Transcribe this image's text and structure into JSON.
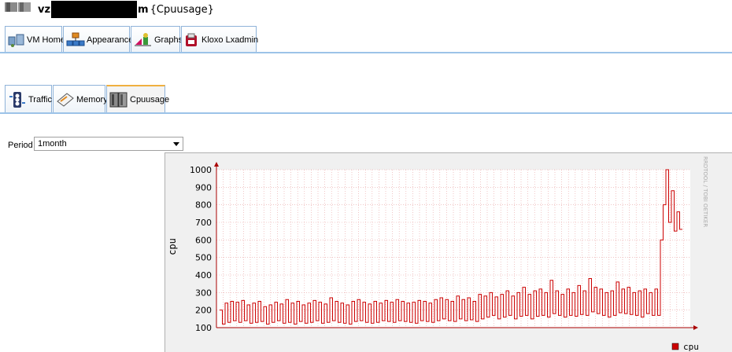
{
  "header": {
    "title_prefix": "vz",
    "title_suffix_bold": "m",
    "title_suffix": "{Cpuusage}"
  },
  "main_tabs": [
    {
      "label": "VM Home",
      "icon": "vm-home-icon"
    },
    {
      "label": "Appearance",
      "icon": "appearance-icon"
    },
    {
      "label": "Graphs",
      "icon": "graphs-icon"
    },
    {
      "label": "Kloxo Lxadmin",
      "icon": "kloxo-icon"
    }
  ],
  "graph_tabs": [
    {
      "label": "Traffic",
      "icon": "traffic-icon",
      "active": false
    },
    {
      "label": "Memory",
      "icon": "memory-icon",
      "active": false
    },
    {
      "label": "Cpuusage",
      "icon": "cpu-icon",
      "active": true
    }
  ],
  "period": {
    "label": "Period",
    "selected": "1month"
  },
  "colors": {
    "line": "#cc0000",
    "grid": "#e8a0a0",
    "tab_border": "#8fb3d9",
    "active_tab_top": "#f0b040"
  },
  "chart_data": {
    "type": "line",
    "ylabel": "cpu",
    "ylim": [
      100,
      1000
    ],
    "yticks": [
      100,
      200,
      300,
      400,
      500,
      600,
      700,
      800,
      900,
      1000
    ],
    "watermark": "RRDTOOL / TOBI OETIKER",
    "series": [
      {
        "name": "cpu",
        "values": [
          200,
          120,
          240,
          130,
          250,
          140,
          245,
          130,
          255,
          140,
          230,
          125,
          240,
          130,
          250,
          135,
          220,
          120,
          230,
          130,
          245,
          140,
          235,
          125,
          260,
          130,
          240,
          120,
          250,
          135,
          230,
          125,
          240,
          130,
          255,
          140,
          245,
          125,
          235,
          130,
          270,
          140,
          250,
          130,
          240,
          125,
          230,
          120,
          250,
          135,
          260,
          140,
          245,
          130,
          235,
          125,
          250,
          130,
          240,
          140,
          255,
          135,
          245,
          130,
          260,
          140,
          250,
          135,
          240,
          130,
          245,
          125,
          255,
          140,
          250,
          135,
          240,
          130,
          260,
          140,
          270,
          150,
          260,
          140,
          250,
          135,
          280,
          150,
          260,
          140,
          270,
          145,
          250,
          135,
          290,
          150,
          280,
          160,
          300,
          170,
          275,
          150,
          290,
          160,
          310,
          170,
          280,
          150,
          300,
          165,
          330,
          170,
          290,
          150,
          310,
          165,
          320,
          170,
          300,
          160,
          370,
          180,
          310,
          170,
          290,
          160,
          320,
          170,
          300,
          165,
          340,
          175,
          310,
          170,
          380,
          190,
          330,
          180,
          320,
          170,
          300,
          160,
          310,
          170,
          360,
          185,
          320,
          180,
          330,
          175,
          300,
          170,
          310,
          160,
          320,
          180,
          300,
          170,
          320,
          170,
          600,
          800,
          1000,
          700,
          880,
          650,
          760,
          660
        ]
      }
    ],
    "legend": [
      {
        "name": "cpu",
        "color": "#cc0000"
      }
    ],
    "legend_position": "bottom-right"
  }
}
